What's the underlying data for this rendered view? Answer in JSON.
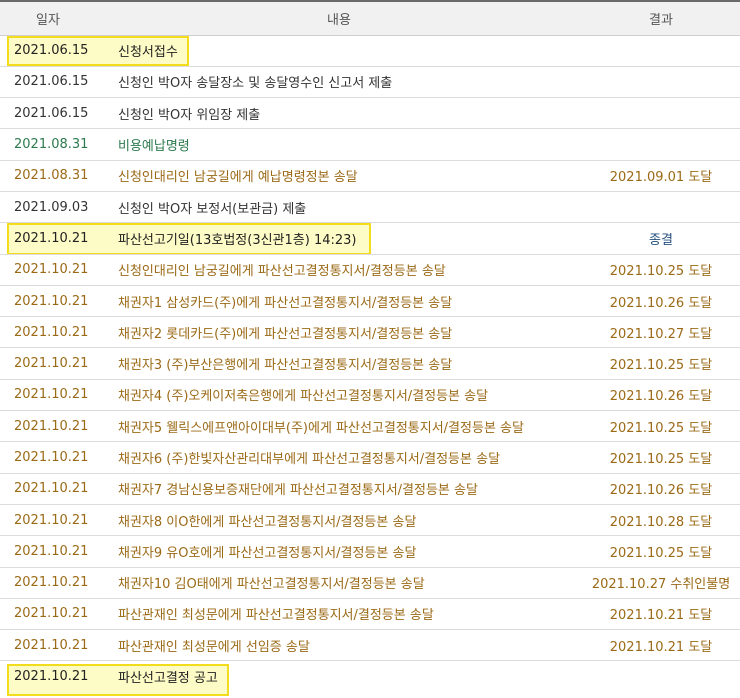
{
  "header": {
    "date": "일자",
    "content": "내용",
    "result": "결과"
  },
  "rows": [
    {
      "date": "2021.06.15",
      "content": "신청서접수",
      "result": ""
    },
    {
      "date": "2021.06.15",
      "content": "신청인 박O자 송달장소 및 송달영수인 신고서 제출",
      "result": ""
    },
    {
      "date": "2021.06.15",
      "content": "신청인 박O자 위임장 제출",
      "result": ""
    },
    {
      "date": "2021.08.31",
      "content": "비용예납명령",
      "result": ""
    },
    {
      "date": "2021.08.31",
      "content": "신청인대리인 남궁길에게 예납명령정본 송달",
      "result": "2021.09.01 도달"
    },
    {
      "date": "2021.09.03",
      "content": "신청인 박O자 보정서(보관금) 제출",
      "result": ""
    },
    {
      "date": "2021.10.21",
      "content": "파산선고기일(13호법정(3신관1층) 14:23)",
      "result": "종결"
    },
    {
      "date": "2021.10.21",
      "content": "신청인대리인 남궁길에게 파산선고결정통지서/결정등본 송달",
      "result": "2021.10.25 도달"
    },
    {
      "date": "2021.10.21",
      "content": "채권자1 삼성카드(주)에게 파산선고결정통지서/결정등본 송달",
      "result": "2021.10.26 도달"
    },
    {
      "date": "2021.10.21",
      "content": "채권자2 롯데카드(주)에게 파산선고결정통지서/결정등본 송달",
      "result": "2021.10.27 도달"
    },
    {
      "date": "2021.10.21",
      "content": "채권자3 (주)부산은행에게 파산선고결정통지서/결정등본 송달",
      "result": "2021.10.25 도달"
    },
    {
      "date": "2021.10.21",
      "content": "채권자4 (주)오케이저축은행에게 파산선고결정통지서/결정등본 송달",
      "result": "2021.10.26 도달"
    },
    {
      "date": "2021.10.21",
      "content": "채권자5 웰릭스에프앤아이대부(주)에게 파산선고결정통지서/결정등본 송달",
      "result": "2021.10.25 도달"
    },
    {
      "date": "2021.10.21",
      "content": "채권자6 (주)한빛자산관리대부에게 파산선고결정통지서/결정등본 송달",
      "result": "2021.10.25 도달"
    },
    {
      "date": "2021.10.21",
      "content": "채권자7 경남신용보증재단에게 파산선고결정통지서/결정등본 송달",
      "result": "2021.10.26 도달"
    },
    {
      "date": "2021.10.21",
      "content": "채권자8 이O한에게 파산선고결정통지서/결정등본 송달",
      "result": "2021.10.28 도달"
    },
    {
      "date": "2021.10.21",
      "content": "채권자9 유O호에게 파산선고결정통지서/결정등본 송달",
      "result": "2021.10.25 도달"
    },
    {
      "date": "2021.10.21",
      "content": "채권자10 김O태에게 파산선고결정통지서/결정등본 송달",
      "result": "2021.10.27 수취인불명"
    },
    {
      "date": "2021.10.21",
      "content": "파산관재인 최성문에게 파산선고결정통지서/결정등본 송달",
      "result": "2021.10.21 도달"
    },
    {
      "date": "2021.10.21",
      "content": "파산관재인 최성문에게 선임증 송달",
      "result": "2021.10.21 도달"
    },
    {
      "date": "2021.10.21",
      "content": "파산선고결정 공고",
      "result": ""
    }
  ]
}
